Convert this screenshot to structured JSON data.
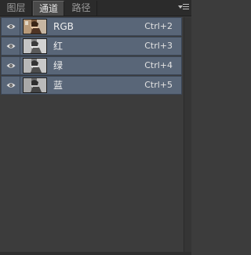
{
  "tabs": [
    {
      "label": "图层"
    },
    {
      "label": "通道"
    },
    {
      "label": "路径"
    }
  ],
  "channels": [
    {
      "name": "RGB",
      "shortcut": "Ctrl+2",
      "thumbnail": "color"
    },
    {
      "name": "红",
      "shortcut": "Ctrl+3",
      "thumbnail": "grayscale"
    },
    {
      "name": "绿",
      "shortcut": "Ctrl+4",
      "thumbnail": "grayscale"
    },
    {
      "name": "蓝",
      "shortcut": "Ctrl+5",
      "thumbnail": "grayscale"
    }
  ],
  "icons": {
    "visibility": "eye-icon",
    "panel_menu": "panel-menu-icon"
  },
  "colors": {
    "row_selected": "#596678",
    "panel_bg": "#3c3c3c"
  }
}
